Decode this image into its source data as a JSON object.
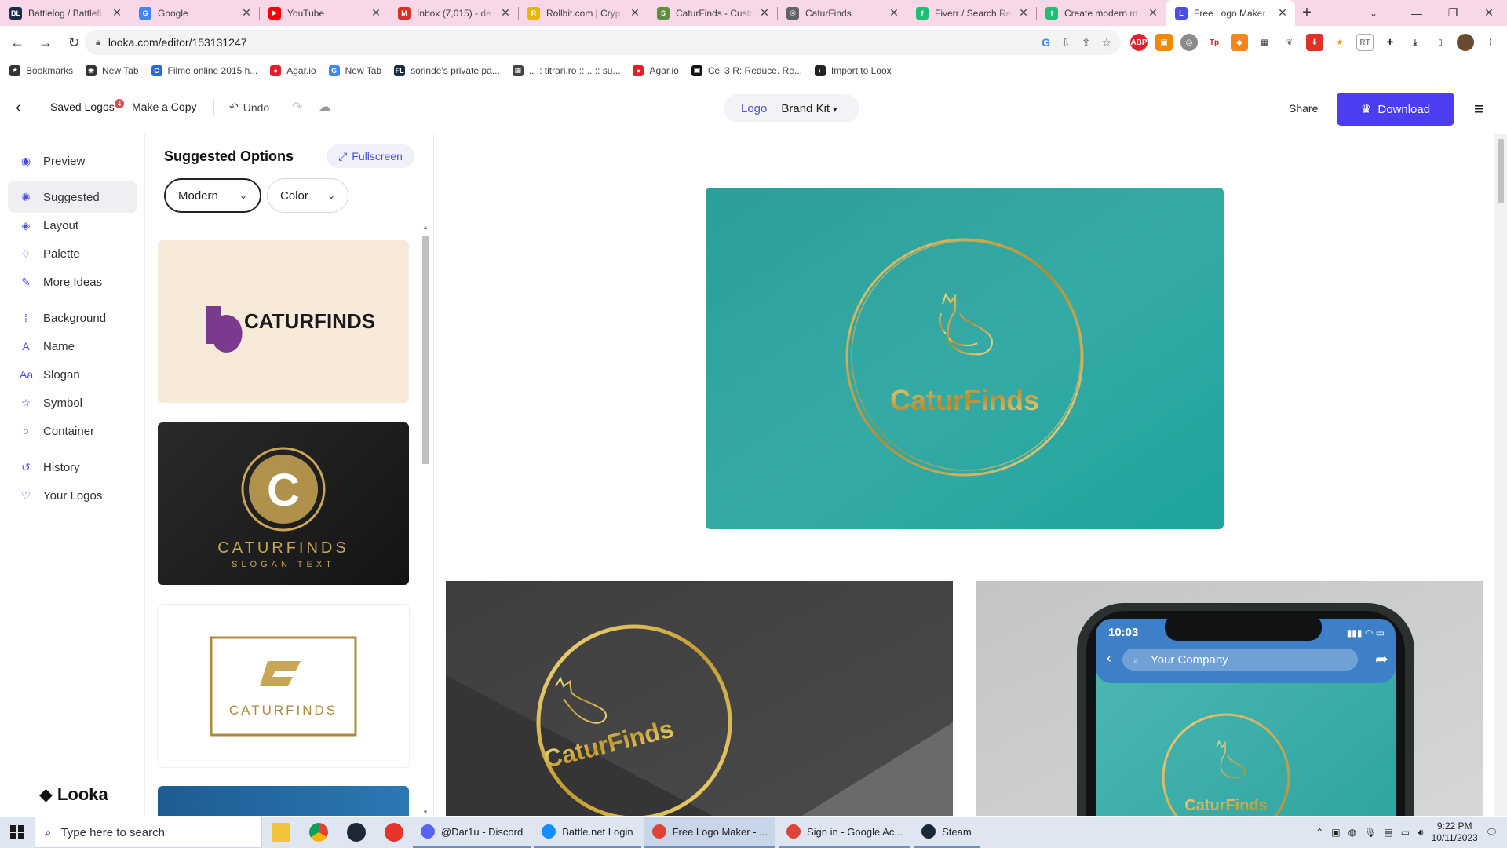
{
  "browser": {
    "tabs": [
      {
        "title": "Battlelog / Battlefi",
        "icon": "battlelog-icon",
        "color": "#1b2b4a",
        "glyph": "BL"
      },
      {
        "title": "Google",
        "icon": "google-icon",
        "color": "#4285f4",
        "glyph": "G"
      },
      {
        "title": "YouTube",
        "icon": "youtube-icon",
        "color": "#ff0000",
        "glyph": "▶"
      },
      {
        "title": "Inbox (7,015) - de",
        "icon": "gmail-icon",
        "color": "#d93025",
        "glyph": "M"
      },
      {
        "title": "Rollbit.com | Cryp",
        "icon": "rollbit-icon",
        "color": "#e6b800",
        "glyph": "R"
      },
      {
        "title": "CaturFinds - Custo",
        "icon": "shopify-icon",
        "color": "#5e8e3e",
        "glyph": "S"
      },
      {
        "title": "CaturFinds",
        "icon": "globe-icon",
        "color": "#5f6368",
        "glyph": "◎"
      },
      {
        "title": "Fiverr / Search Re",
        "icon": "fiverr-icon",
        "color": "#1dbf73",
        "glyph": "f"
      },
      {
        "title": "Create modern m",
        "icon": "fiverr-icon",
        "color": "#1dbf73",
        "glyph": "f"
      },
      {
        "title": "Free Logo Maker",
        "icon": "looka-icon",
        "color": "#4b4ee0",
        "glyph": "L",
        "active": true
      }
    ],
    "url": "looka.com/editor/153131247",
    "bookmarks": [
      {
        "label": "Bookmarks",
        "icon": "star-icon",
        "color": "#333333",
        "glyph": "★"
      },
      {
        "label": "New Tab",
        "icon": "chrome-icon",
        "color": "#333333",
        "glyph": "◉"
      },
      {
        "label": "Filme online 2015 h...",
        "icon": "film-icon",
        "color": "#2a6ad8",
        "glyph": "C"
      },
      {
        "label": "Agar.io",
        "icon": "agario-icon",
        "color": "#e0202a",
        "glyph": "●"
      },
      {
        "label": "New Tab",
        "icon": "google-icon",
        "color": "#4285f4",
        "glyph": "G"
      },
      {
        "label": "sorinde's private pa...",
        "icon": "page-icon",
        "color": "#1b2b4a",
        "glyph": "FL"
      },
      {
        "label": ".. :: titrari.ro :: .. :: su...",
        "icon": "grid-icon",
        "color": "#444444",
        "glyph": "▦"
      },
      {
        "label": "Agar.io",
        "icon": "agario-icon",
        "color": "#e0202a",
        "glyph": "●"
      },
      {
        "label": "Cei 3 R: Reduce. Re...",
        "icon": "recycle-icon",
        "color": "#111111",
        "glyph": "▣"
      },
      {
        "label": "Import to Loox",
        "icon": "loox-icon",
        "color": "#222222",
        "glyph": "◐"
      }
    ]
  },
  "header": {
    "saved_logos": "Saved Logos",
    "saved_badge": "4",
    "make_copy": "Make a Copy",
    "undo": "Undo",
    "tab_logo": "Logo",
    "tab_brand_kit": "Brand Kit",
    "share": "Share",
    "download": "Download"
  },
  "sidebar": {
    "items": [
      {
        "label": "Preview",
        "icon": "eye-icon",
        "glyph": "◉"
      },
      {
        "label": "Suggested",
        "icon": "sparkle-icon",
        "glyph": "✺",
        "active": true
      },
      {
        "label": "Layout",
        "icon": "layers-icon",
        "glyph": "◈"
      },
      {
        "label": "Palette",
        "icon": "droplet-icon",
        "glyph": "♢"
      },
      {
        "label": "More Ideas",
        "icon": "pin-icon",
        "glyph": "✎"
      },
      {
        "label": "Background",
        "icon": "dots-grid-icon",
        "glyph": "⁞"
      },
      {
        "label": "Name",
        "icon": "text-box-icon",
        "glyph": "A"
      },
      {
        "label": "Slogan",
        "icon": "slogan-icon",
        "glyph": "Aa"
      },
      {
        "label": "Symbol",
        "icon": "star-outline-icon",
        "glyph": "☆"
      },
      {
        "label": "Container",
        "icon": "circle-icon",
        "glyph": "○"
      },
      {
        "label": "History",
        "icon": "history-icon",
        "glyph": "↺"
      },
      {
        "label": "Your Logos",
        "icon": "heart-icon",
        "glyph": "♡"
      }
    ],
    "brand": "Looka"
  },
  "suggestions": {
    "title": "Suggested Options",
    "fullscreen": "Fullscreen",
    "filter_style": "Modern",
    "filter_color": "Color",
    "cards": [
      {
        "name": "CATURFINDS",
        "bg": "#f7eadb",
        "accent": "#7a3b8f"
      },
      {
        "name": "CATURFINDS",
        "slogan": "SLOGAN TEXT",
        "letter": "C",
        "bg": "#1e1e1e",
        "accent": "#c9a655"
      },
      {
        "name": "CATURFINDS",
        "bg": "#ffffff",
        "accent": "#b08a3e"
      }
    ]
  },
  "preview": {
    "brand_name": "CaturFinds",
    "bg_color": "#2aa9a3",
    "gold": "#c9a74b",
    "phone_time": "10:03",
    "phone_search": "Your Company"
  },
  "taskbar": {
    "search_placeholder": "Type here to search",
    "apps": [
      {
        "label": "@Dar1u - Discord",
        "icon": "discord-icon",
        "color": "#5865f2"
      },
      {
        "label": "Battle.net Login",
        "icon": "battlenet-icon",
        "color": "#148eff"
      },
      {
        "label": "Free Logo Maker - ...",
        "icon": "chrome-icon",
        "color": "#db4437",
        "active": true
      },
      {
        "label": "Sign in - Google Ac...",
        "icon": "chrome-icon",
        "color": "#db4437"
      },
      {
        "label": "Steam",
        "icon": "steam-icon",
        "color": "#1b2838"
      }
    ],
    "time": "9:22 PM",
    "date": "10/11/2023"
  }
}
